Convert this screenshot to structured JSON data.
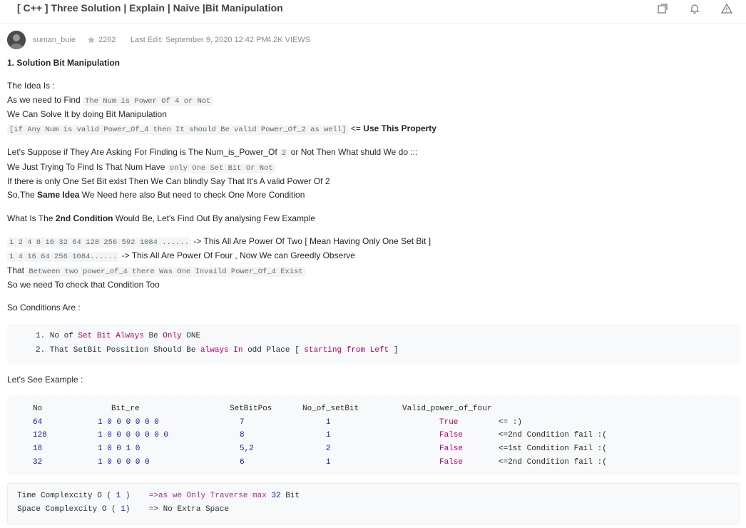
{
  "header": {
    "title": "[ C++ ] Three Solution | Explain | Naive |Bit Manipulation"
  },
  "meta": {
    "username": "suman_buie",
    "reputation": "2262",
    "edit": "Last Edit: September 9, 2020 12:42 PM",
    "views": "4.2K VIEWS"
  },
  "content": {
    "heading": "1. Solution Bit Manipulation",
    "l1": "The Idea Is :",
    "l2a": "As we need to Find",
    "l2code": "The Num is Power Of 4 or Not",
    "l3": "We Can Solve It by doing Bit Manipulation",
    "l4code": "[if Any Num is valid Power_Of_4 then It should Be valid Power_Of_2 as well]",
    "l4a": "<=",
    "l4b": "Use This Property",
    "l5a": "Let's Suppose if They Are Asking For Finding is The Num_is_Power_Of",
    "l5code": "2",
    "l5b": "or Not Then What shuld We do :::",
    "l6a": "We Just Trying To Find Is That Num Have",
    "l6code": "only One Set Bit Or Not",
    "l7": "If there is only One Set Bit exist Then We Can blindly Say That It's A valid Power Of 2",
    "l8a": "So,The",
    "l8b": "Same Idea",
    "l8c": "We Need here also But need to check One More Condition",
    "l9a": "What Is The",
    "l9b": "2nd Condition",
    "l9c": "Would Be, Let's Find Out By analysing Few Example",
    "l10code": "1 2 4 8 16 32 64 128 256 592 1084 ......",
    "l10b": "-> This All Are Power Of Two [ Mean Having Only One Set Bit ]",
    "l11code": "1 4 16 64 256 1084......",
    "l11b": "-> This All Are Power Of Four , Now We can Greedly Observe",
    "l12a": "That",
    "l12code": "Between two power_of_4 there Was One Invaild Power_Of_4 Exist",
    "l13": "So we need To check that Condition Too",
    "l14": "So Conditions Are :",
    "l15": "Let's See Example :"
  },
  "conditions": {
    "c1": [
      "1. No of ",
      "Set Bit",
      " ",
      "Always",
      " Be ",
      "Only",
      " ONE"
    ],
    "c2": [
      "2. That SetBit Possition Should Be ",
      "always",
      " ",
      "In",
      " odd Place [ ",
      "starting",
      " ",
      "from",
      " ",
      "Left",
      " ]"
    ]
  },
  "example_table": {
    "headers": [
      "No",
      "Bit_re",
      "SetBitPos",
      "No_of_setBit",
      "Valid_power_of_four",
      ""
    ],
    "rows": [
      [
        "64",
        "1 0 0 0 0 0 0",
        "7",
        "1",
        "True",
        "<= :)"
      ],
      [
        "128",
        "1 0 0 0 0 0 0 0",
        "8",
        "1",
        "False",
        "<=2nd Condition fail :("
      ],
      [
        "18",
        "1 0 0 1 0",
        "5,2",
        "2",
        "False",
        "<=1st Condition Fail :("
      ],
      [
        "32",
        "1 0 0 0 0 0",
        "6",
        "1",
        "False",
        "<=2nd Condition fail :("
      ]
    ]
  },
  "complexity": {
    "time": [
      "Time Complexcity O ( ",
      "1",
      " )    ",
      "=>as we Only Traverse max ",
      "32",
      " Bit"
    ],
    "space": [
      "Space Complexcity O ( ",
      "1",
      ")    ",
      "=> No Extra Space"
    ]
  },
  "colors": {
    "accent_purple": "#b5006c",
    "number_blue": "#1a1aa6",
    "code_bg": "#f4f4f4"
  },
  "icons": [
    "share-icon",
    "bell-icon",
    "report-icon",
    "star-icon"
  ]
}
